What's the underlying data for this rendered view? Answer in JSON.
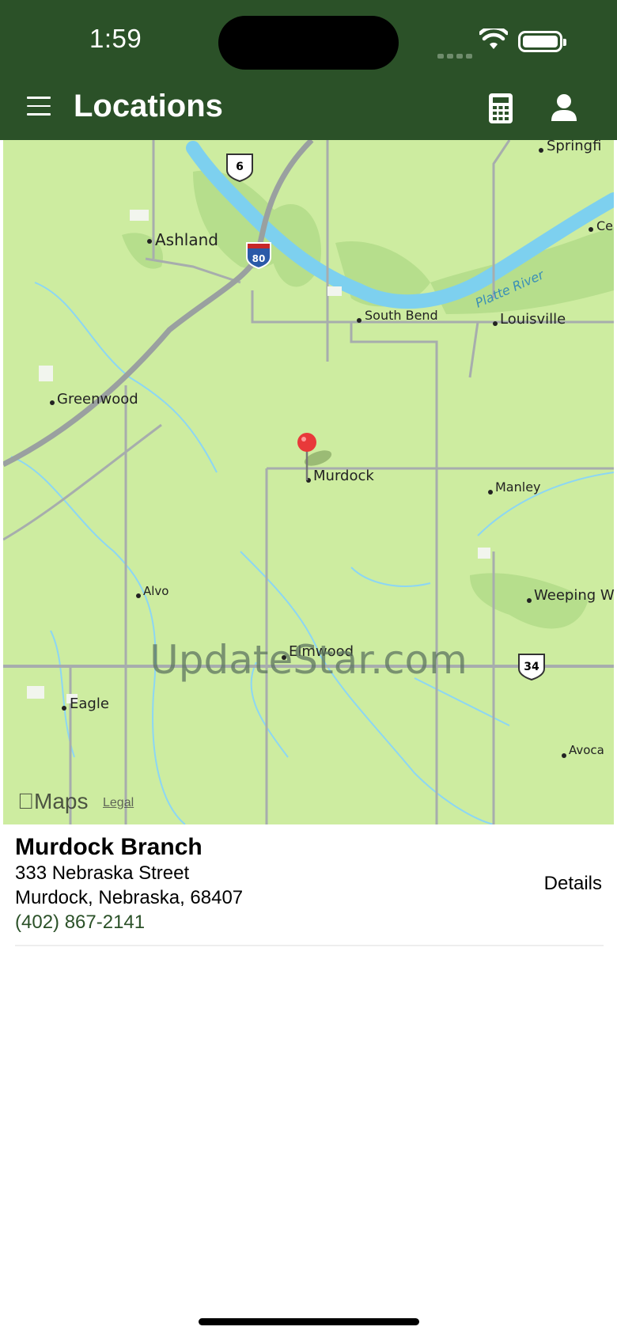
{
  "status_bar": {
    "time": "1:59"
  },
  "header": {
    "title": "Locations"
  },
  "map": {
    "watermark": "UpdateStar.com",
    "maps_logo": "Maps",
    "legal_label": "Legal",
    "places": [
      {
        "name": "Ashland"
      },
      {
        "name": "South Bend"
      },
      {
        "name": "Louisville"
      },
      {
        "name": "Greenwood"
      },
      {
        "name": "Murdock"
      },
      {
        "name": "Manley"
      },
      {
        "name": "Alvo"
      },
      {
        "name": "Weeping W"
      },
      {
        "name": "Elmwood"
      },
      {
        "name": "Eagle"
      },
      {
        "name": "Avoca"
      },
      {
        "name": "Springfi"
      },
      {
        "name": "Ce"
      },
      {
        "name": "Platte River"
      }
    ],
    "route_shields": [
      "6",
      "80",
      "34"
    ],
    "colors": {
      "land": "#cdeca0",
      "water": "#7dd0ef",
      "road": "#9aa0a0",
      "pin": "#e8393a"
    }
  },
  "location": {
    "name": "Murdock Branch",
    "street": "333 Nebraska Street",
    "city_line": "Murdock, Nebraska, 68407",
    "phone": "(402) 867-2141",
    "details_label": "Details"
  },
  "colors": {
    "brand": "#2b5128"
  }
}
